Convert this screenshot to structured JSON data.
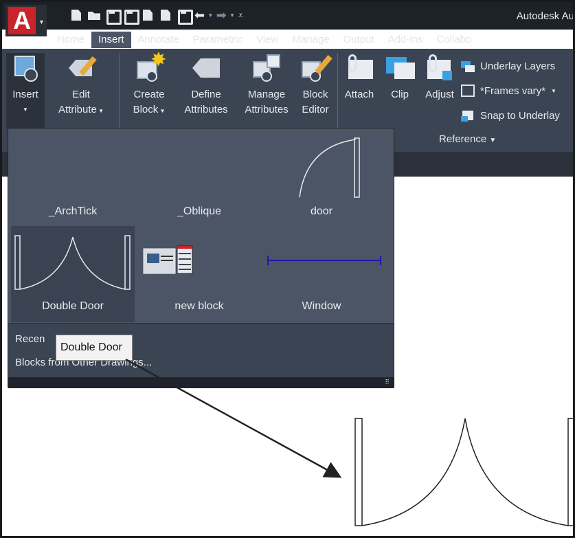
{
  "app": {
    "title": "Autodesk Au",
    "logo_letter": "A",
    "logo_icon": "autocad-app-icon",
    "accent": "#c8242a"
  },
  "quick_access": [
    {
      "icon": "new-icon"
    },
    {
      "icon": "open-icon"
    },
    {
      "icon": "save-icon"
    },
    {
      "icon": "save-as-icon"
    },
    {
      "icon": "plot-icon"
    },
    {
      "icon": "import-icon"
    },
    {
      "icon": "print-icon"
    },
    {
      "icon": "undo-icon"
    },
    {
      "icon": "redo-icon"
    },
    {
      "icon": "customize-qat-icon"
    }
  ],
  "tabs": [
    {
      "label": "Home",
      "active": false
    },
    {
      "label": "Insert",
      "active": true
    },
    {
      "label": "Annotate",
      "active": false
    },
    {
      "label": "Parametric",
      "active": false
    },
    {
      "label": "View",
      "active": false
    },
    {
      "label": "Manage",
      "active": false
    },
    {
      "label": "Output",
      "active": false
    },
    {
      "label": "Add-ins",
      "active": false
    },
    {
      "label": "Collabo",
      "active": false
    }
  ],
  "ribbon": {
    "insert": {
      "line1": "Insert",
      "icon": "insert-block-icon"
    },
    "edit_attribute": {
      "line1": "Edit",
      "line2": "Attribute",
      "icon": "edit-attribute-icon"
    },
    "create_block": {
      "line1": "Create",
      "line2": "Block",
      "icon": "create-block-icon"
    },
    "define_attributes": {
      "line1": "Define",
      "line2": "Attributes",
      "icon": "define-attributes-icon"
    },
    "manage_attributes": {
      "line1": "Manage",
      "line2": "Attributes",
      "icon": "manage-attributes-icon"
    },
    "block_editor": {
      "line1": "Block",
      "line2": "Editor",
      "icon": "block-editor-icon"
    },
    "attach": {
      "label": "Attach",
      "icon": "attach-icon"
    },
    "clip": {
      "label": "Clip",
      "icon": "clip-icon"
    },
    "adjust": {
      "label": "Adjust",
      "icon": "adjust-icon"
    },
    "underlay_layers": {
      "label": "Underlay Layers",
      "icon": "underlay-layers-icon"
    },
    "frames_vary": {
      "label": "*Frames vary*",
      "icon": "frames-icon"
    },
    "snap_to_underlay": {
      "label": "Snap to Underlay",
      "icon": "snap-underlay-icon"
    },
    "reference_panel": {
      "label": "Reference"
    }
  },
  "gallery": {
    "items": [
      {
        "label": "_ArchTick",
        "preview": "empty"
      },
      {
        "label": "_Oblique",
        "preview": "empty"
      },
      {
        "label": "door",
        "preview": "door"
      },
      {
        "label": "Double Door",
        "preview": "double-door",
        "selected": true
      },
      {
        "label": "new block",
        "preview": "new-block"
      },
      {
        "label": "Window",
        "preview": "window"
      }
    ],
    "menu": {
      "recent": "Recent Blocks...",
      "recent_visible": "Recen",
      "from_other": "Blocks from Other Drawings...",
      "from_other_visible": "Blocks from Other Drawings..."
    }
  },
  "tooltip": {
    "text": "Double Door"
  },
  "drawing": {
    "block_name": "Double Door",
    "stroke": "#222222",
    "window_line": "#1a1aaa"
  }
}
